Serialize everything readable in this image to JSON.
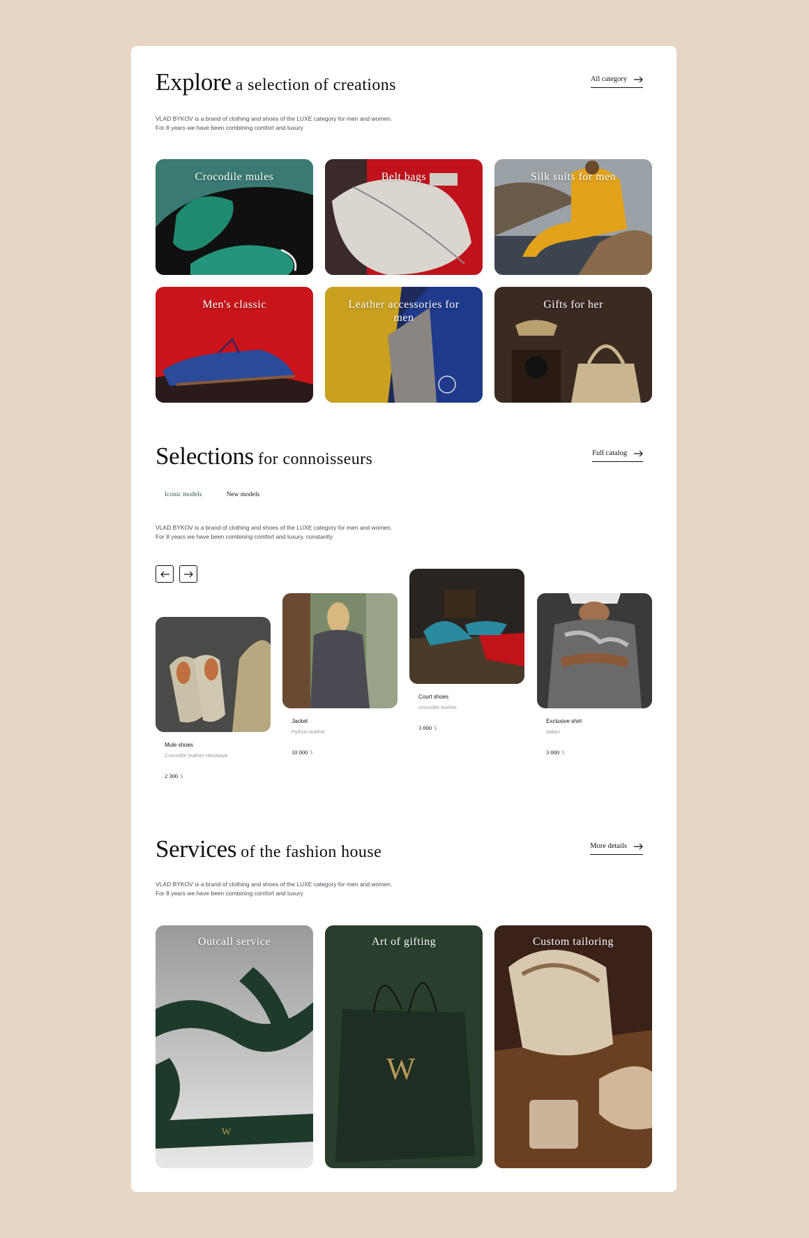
{
  "explore": {
    "title_big": "Explore",
    "title_small": "a selection of creations",
    "link": "All category",
    "desc_line1": "VLAD BYKOV is a brand of clothing and shoes of the LUXE category for men and women.",
    "desc_line2": "For 8 years we have been combining comfort and luxury",
    "categories": [
      {
        "label": "Crocodile mules"
      },
      {
        "label": "Belt bags"
      },
      {
        "label": "Silk suits for men"
      },
      {
        "label": "Men's classic"
      },
      {
        "label": "Leather accessories for men"
      },
      {
        "label": "Gifts for her"
      }
    ]
  },
  "selections": {
    "title_big": "Selections",
    "title_small": "for connoisseurs",
    "link": "Full catalog",
    "tabs": [
      {
        "label": "Iconic models",
        "active": true
      },
      {
        "label": "New models",
        "active": false
      }
    ],
    "desc_line1": "VLAD BYKOV is a brand of clothing and shoes of the LUXE category for men and women.",
    "desc_line2": "For 8 years we have been combining comfort and luxury, constantly",
    "prev_icon": "arrow-left-icon",
    "next_icon": "arrow-right-icon",
    "products": [
      {
        "name": "Mule shoes",
        "sub": "Crocodile leather Himalaya",
        "price": "2 300",
        "currency": "$"
      },
      {
        "name": "Jacket",
        "sub": "Python leather",
        "price": "10 000",
        "currency": "$"
      },
      {
        "name": "Court shoes",
        "sub": "crocodile leather",
        "price": "3 000",
        "currency": "$"
      },
      {
        "name": "Exclusive shirt",
        "sub": "Italian",
        "price": "3 000",
        "currency": "$"
      }
    ]
  },
  "services": {
    "title_big": "Services",
    "title_small": "of the fashion house",
    "link": "More details",
    "desc_line1": "VLAD BYKOV is a brand of clothing and shoes of the LUXE category for men and women.",
    "desc_line2": "For 8 years we have been combining comfort and luxury",
    "items": [
      {
        "label": "Outcall service"
      },
      {
        "label": "Art of gifting"
      },
      {
        "label": "Custom tailoring"
      }
    ]
  },
  "colors": {
    "background": "#e8d6c5",
    "card": "#ffffff",
    "accent_green": "#2f5a44",
    "text": "#111111",
    "muted": "#9a9aa2"
  }
}
